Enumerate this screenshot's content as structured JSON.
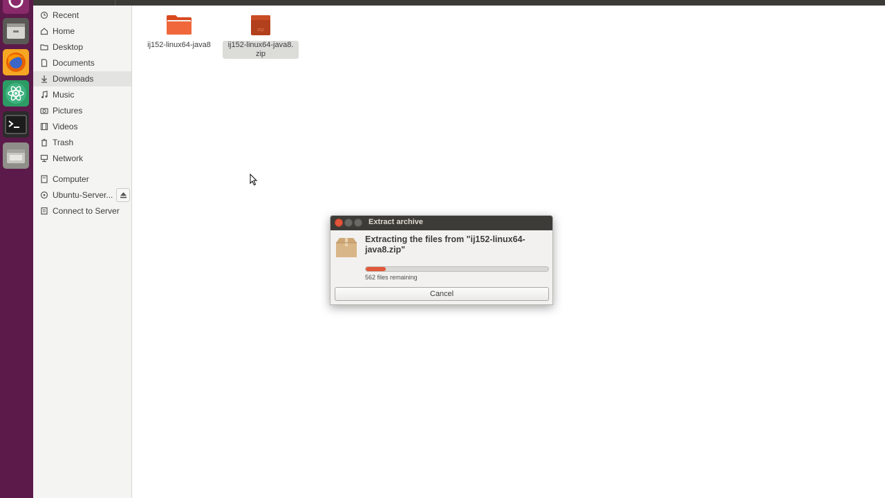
{
  "launcher": {
    "items": [
      {
        "icon": "ubuntu-logo-icon"
      },
      {
        "icon": "file-manager-icon"
      },
      {
        "icon": "firefox-icon"
      },
      {
        "icon": "atom-editor-icon"
      },
      {
        "icon": "terminal-icon"
      },
      {
        "icon": "archive-manager-icon"
      }
    ]
  },
  "sidebar": {
    "items": [
      {
        "label": "Recent",
        "icon": "clock-icon"
      },
      {
        "label": "Home",
        "icon": "home-icon"
      },
      {
        "label": "Desktop",
        "icon": "folder-icon"
      },
      {
        "label": "Documents",
        "icon": "document-icon"
      },
      {
        "label": "Downloads",
        "icon": "download-icon",
        "active": true
      },
      {
        "label": "Music",
        "icon": "music-icon"
      },
      {
        "label": "Pictures",
        "icon": "camera-icon"
      },
      {
        "label": "Videos",
        "icon": "video-icon"
      },
      {
        "label": "Trash",
        "icon": "trash-icon"
      },
      {
        "label": "Network",
        "icon": "network-icon"
      },
      {
        "label": "Computer",
        "icon": "computer-icon"
      },
      {
        "label": "Ubuntu-Server...",
        "icon": "disc-icon"
      },
      {
        "label": "Connect to Server",
        "icon": "server-icon"
      }
    ]
  },
  "files": [
    {
      "name": "ij152-linux64-java8",
      "type": "folder"
    },
    {
      "name": "ij152-linux64-java8.\nzip",
      "type": "zip",
      "badge": "zip",
      "selected": true
    }
  ],
  "dialog": {
    "title": "Extract archive",
    "heading": "Extracting the files from \"ij152-linux64-java8.zip\"",
    "progress": 0.11,
    "status": "562 files remaining",
    "cancel_label": "Cancel"
  },
  "colors": {
    "launcher_bg": "#5c1a4a",
    "accent": "#e1593a",
    "titlebar": "#3c3b37"
  }
}
